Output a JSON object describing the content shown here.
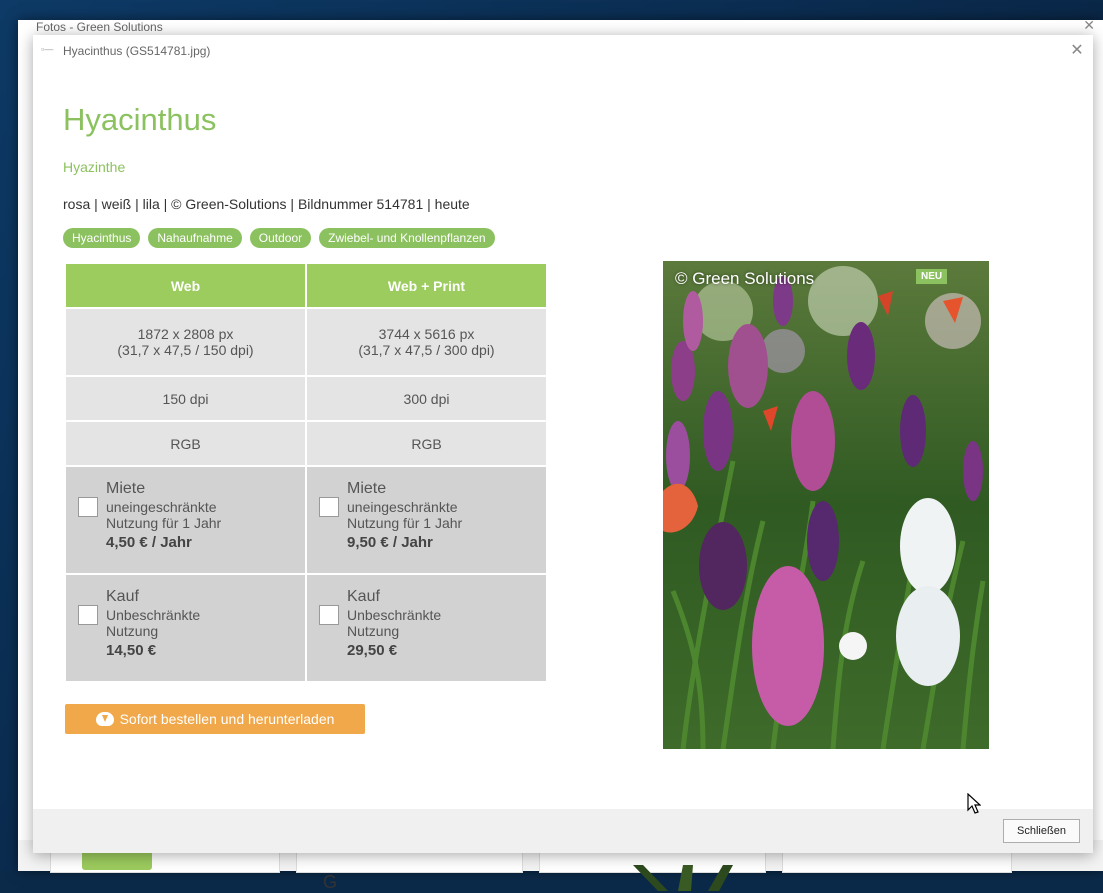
{
  "background_window": {
    "title": "Fotos - Green Solutions",
    "snippet_text": "G"
  },
  "dialog": {
    "title": "Hyacinthus (GS514781.jpg)",
    "close_icon": "close-icon"
  },
  "photo_info": {
    "name": "Hyacinthus",
    "common_name": "Hyazinthe",
    "meta": "rosa | weiß | lila | © Green-Solutions | Bildnummer 514781 | heute"
  },
  "tags": [
    "Hyacinthus",
    "Nahaufnahme",
    "Outdoor",
    "Zwiebel- und Knollenpflanzen"
  ],
  "pricing": {
    "columns": [
      "Web",
      "Web + Print"
    ],
    "resolution": [
      {
        "px": "1872 x 2808 px",
        "size": "(31,7 x 47,5 / 150 dpi)"
      },
      {
        "px": "3744 x 5616 px",
        "size": "(31,7 x 47,5 / 300 dpi)"
      }
    ],
    "dpi": [
      "150 dpi",
      "300 dpi"
    ],
    "color_mode": [
      "RGB",
      "RGB"
    ],
    "rent": [
      {
        "title": "Miete",
        "desc1": "uneingeschränkte",
        "desc2": "Nutzung für 1 Jahr",
        "price": "4,50 € / Jahr"
      },
      {
        "title": "Miete",
        "desc1": "uneingeschränkte",
        "desc2": "Nutzung für 1 Jahr",
        "price": "9,50 € / Jahr"
      }
    ],
    "buy": [
      {
        "title": "Kauf",
        "desc1": "Unbeschränkte",
        "desc2": "Nutzung",
        "price": "14,50 €"
      },
      {
        "title": "Kauf",
        "desc1": "Unbeschränkte",
        "desc2": "Nutzung",
        "price": "29,50 €"
      }
    ]
  },
  "order_button": {
    "label": "Sofort bestellen und herunterladen",
    "icon": "cloud-download-icon"
  },
  "image": {
    "watermark": "© Green Solutions",
    "badge": "NEU"
  },
  "footer": {
    "close_label": "Schließen"
  },
  "colors": {
    "brand_green": "#8cc160",
    "header_green": "#9ccb5e",
    "order_orange": "#f0a84a"
  }
}
